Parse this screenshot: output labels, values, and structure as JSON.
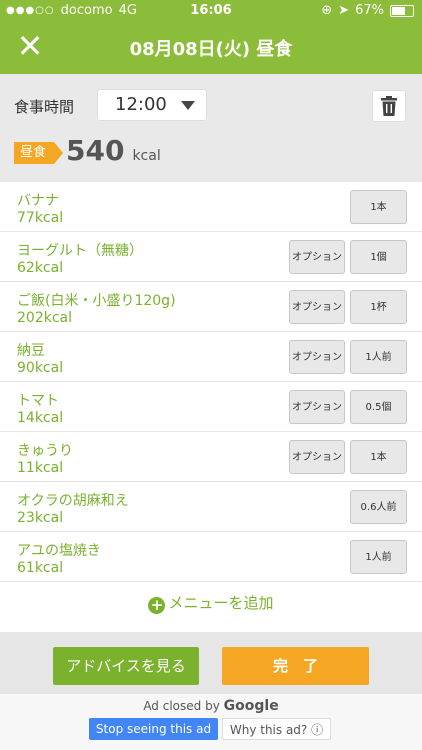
{
  "status_bar": {
    "carrier": "docomo",
    "network": "4G",
    "time": "16:06",
    "battery": "67%"
  },
  "header": {
    "close_icon": "close-icon",
    "title": "08月08日(火) 昼食"
  },
  "meal": {
    "time_label": "食事時間",
    "time_value": "12:00",
    "tag": "昼食",
    "total_kcal": "540",
    "kcal_unit": "kcal"
  },
  "items": [
    {
      "name": "バナナ",
      "kcal": "77kcal",
      "option": null,
      "qty": "1本"
    },
    {
      "name": "ヨーグルト（無糖）",
      "kcal": "62kcal",
      "option": "オプション",
      "qty": "1個"
    },
    {
      "name": "ご飯(白米・小盛り120g)",
      "kcal": "202kcal",
      "option": "オプション",
      "qty": "1杯"
    },
    {
      "name": "納豆",
      "kcal": "90kcal",
      "option": "オプション",
      "qty": "1人前"
    },
    {
      "name": "トマト",
      "kcal": "14kcal",
      "option": "オプション",
      "qty": "0.5個"
    },
    {
      "name": "きゅうり",
      "kcal": "11kcal",
      "option": "オプション",
      "qty": "1本"
    },
    {
      "name": "オクラの胡麻和え",
      "kcal": "23kcal",
      "option": null,
      "qty": "0.6人前"
    },
    {
      "name": "アユの塩焼き",
      "kcal": "61kcal",
      "option": null,
      "qty": "1人前"
    }
  ],
  "add_menu_label": "メニューを追加",
  "footer": {
    "advice_label": "アドバイスを見る",
    "done_label": "完　了"
  },
  "ad": {
    "closed_by": "Ad closed by",
    "google": "Google",
    "stop_label": "Stop seeing this ad",
    "why_label": "Why this ad? ⓘ"
  },
  "colors": {
    "header": "#8cbd3a",
    "accent_green": "#7ab22e",
    "accent_orange": "#f5a623",
    "ad_blue": "#4285f4"
  }
}
